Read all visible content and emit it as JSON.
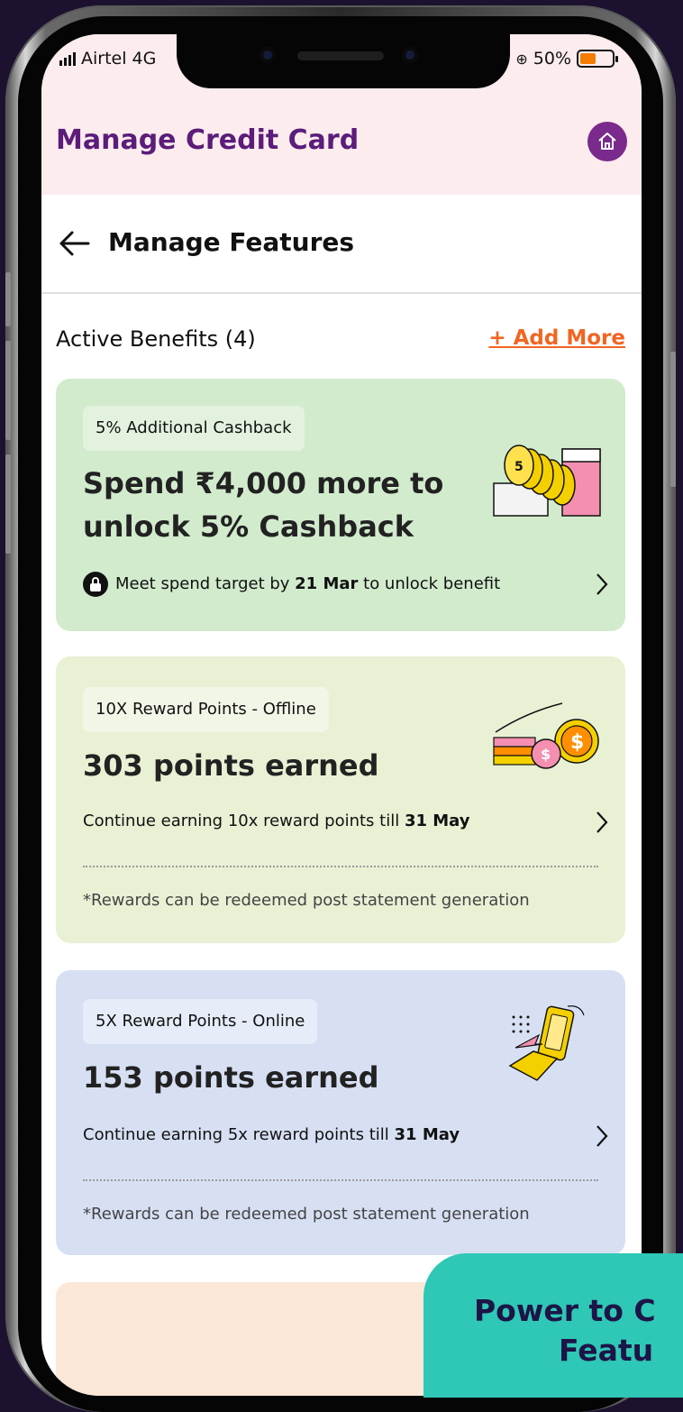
{
  "status_bar": {
    "carrier": "Airtel 4G",
    "battery_percent": "50%"
  },
  "header": {
    "title": "Manage Credit Card",
    "home_icon": "home-icon"
  },
  "nav": {
    "title": "Manage Features",
    "back_icon": "arrow-left-icon"
  },
  "section": {
    "title": "Active Benefits (4)",
    "add_more_label": "+ Add More"
  },
  "cards": [
    {
      "chip": "5% Additional Cashback",
      "title_line1": "Spend ₹4,000 more to",
      "title_line2": "unlock 5% Cashback",
      "text_prefix": "Meet spend target by ",
      "text_bold": "21 Mar",
      "text_suffix": " to unlock benefit",
      "bg": "#d2ebcd",
      "chip_bg": "#e3f2de"
    },
    {
      "chip": "10X Reward Points - Offline",
      "title": "303 points earned",
      "text_prefix": "Continue earning 10x reward points till ",
      "text_bold": "31 May",
      "note": "*Rewards can be redeemed post statement generation",
      "bg": "#e8f1d4",
      "chip_bg": "#f2f6e6"
    },
    {
      "chip": "5X Reward Points - Online",
      "title": "153 points earned",
      "text_prefix": "Continue earning 5x reward points till ",
      "text_bold": "31 May",
      "note": "*Rewards can be redeemed post statement generation",
      "bg": "#d7e0f3",
      "chip_bg": "#e6ecf8"
    }
  ],
  "promo": {
    "line1": "Power to C",
    "line2": "Featu"
  }
}
